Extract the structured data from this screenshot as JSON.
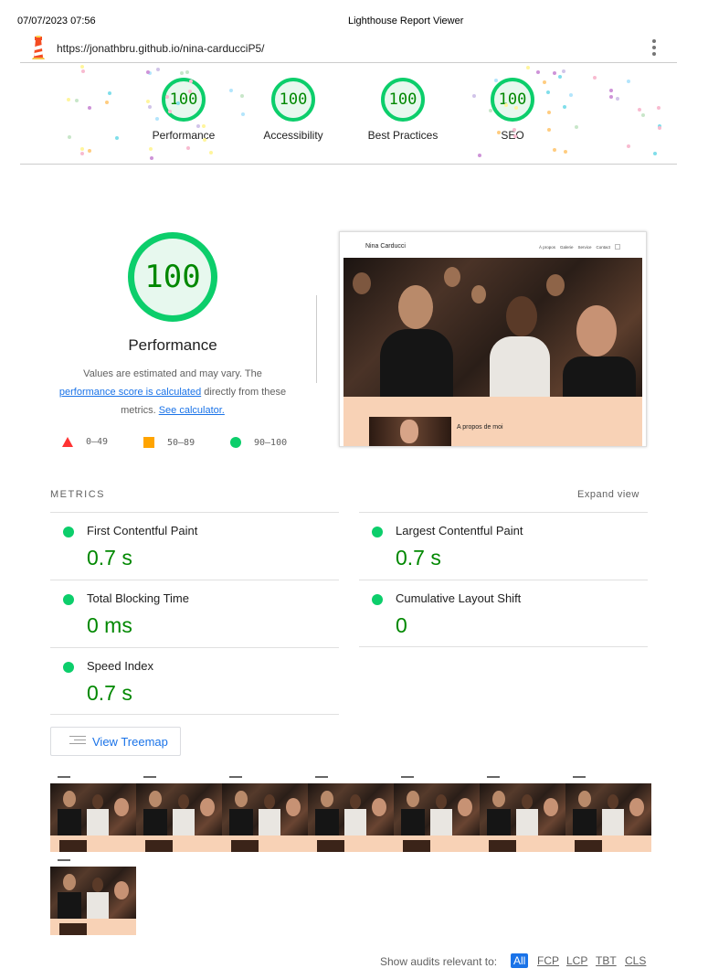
{
  "print_header": {
    "date": "07/07/2023 07:56",
    "title": "Lighthouse Report Viewer"
  },
  "topbar": {
    "url": "https://jonathbru.github.io/nina-carducciP5/",
    "logo_icon": "lighthouse-icon",
    "menu_icon": "kebab-menu-icon"
  },
  "categories": [
    {
      "score": "100",
      "label": "Performance"
    },
    {
      "score": "100",
      "label": "Accessibility"
    },
    {
      "score": "100",
      "label": "Best Practices"
    },
    {
      "score": "100",
      "label": "SEO"
    }
  ],
  "performance": {
    "score": "100",
    "label": "Performance",
    "desc_1": "Values are estimated and may vary. The ",
    "desc_link_1": "performance score is calculated",
    "desc_2": " directly from these metrics. ",
    "desc_link_2": "See calculator."
  },
  "legend": {
    "fail": "0–49",
    "average": "50–89",
    "pass": "90–100"
  },
  "final_screenshot": {
    "brand": "Nina Carducci",
    "nav": [
      "À propos",
      "Galerie",
      "Service",
      "Contact"
    ],
    "section_title": "A propos de moi"
  },
  "metrics_section": {
    "heading": "METRICS",
    "expand": "Expand view",
    "items": [
      {
        "title": "First Contentful Paint",
        "value": "0.7 s"
      },
      {
        "title": "Largest Contentful Paint",
        "value": "0.7 s"
      },
      {
        "title": "Total Blocking Time",
        "value": "0 ms"
      },
      {
        "title": "Cumulative Layout Shift",
        "value": "0"
      },
      {
        "title": "Speed Index",
        "value": "0.7 s"
      }
    ]
  },
  "treemap_button": {
    "label": "View Treemap"
  },
  "filmstrip_count": 8,
  "audit_filter": {
    "label": "Show audits relevant to:",
    "options": [
      "All",
      "FCP",
      "LCP",
      "TBT",
      "CLS"
    ],
    "active": "All"
  },
  "colors": {
    "pass": "#0cce6b",
    "pass_text": "#008800",
    "average": "#ffa400",
    "fail": "#ff3333",
    "link": "#1a73e8"
  }
}
